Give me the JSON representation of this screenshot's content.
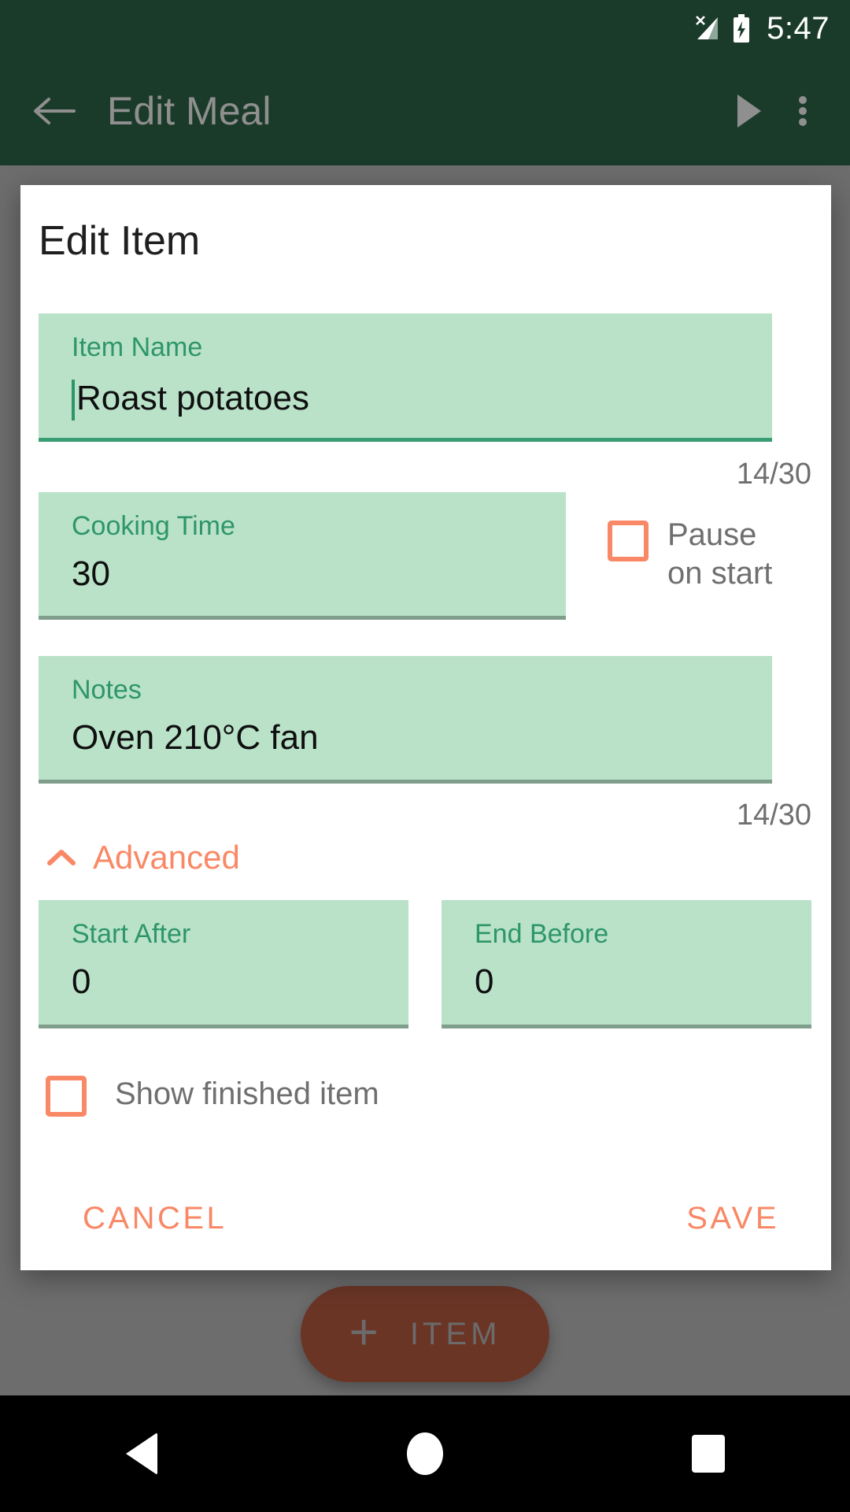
{
  "status_bar": {
    "clock": "5:47",
    "signal_icon": "signal-no-sim-icon",
    "battery_icon": "battery-charging-icon"
  },
  "app_bar": {
    "back_icon": "arrow-back-icon",
    "title": "Edit Meal",
    "play_icon": "play-icon",
    "overflow_icon": "overflow-menu-icon"
  },
  "background": {
    "fab": {
      "plus_icon": "plus-icon",
      "label": "ITEM"
    }
  },
  "dialog": {
    "title": "Edit Item",
    "fields": {
      "item_name": {
        "label": "Item Name",
        "value": "Roast potatoes",
        "counter": "14/30",
        "focused": true
      },
      "cooking_time": {
        "label": "Cooking Time",
        "value": "30",
        "focused": false
      },
      "notes": {
        "label": "Notes",
        "value": "Oven 210°C fan",
        "counter": "14/30",
        "focused": false
      },
      "start_after": {
        "label": "Start After",
        "value": "0",
        "focused": false
      },
      "end_before": {
        "label": "End Before",
        "value": "0",
        "focused": false
      }
    },
    "checkboxes": {
      "pause_on_start": {
        "label": "Pause\non start",
        "checked": false
      },
      "show_finished_item": {
        "label": "Show finished item",
        "checked": false
      }
    },
    "advanced": {
      "label": "Advanced",
      "chevron_icon": "chevron-up-icon",
      "expanded": true
    },
    "actions": {
      "cancel": "CANCEL",
      "save": "SAVE"
    }
  },
  "nav_bar": {
    "back_icon": "nav-back-icon",
    "home_icon": "nav-home-icon",
    "recents_icon": "nav-recents-icon"
  },
  "colors": {
    "app_bar": "#1b3b2a",
    "field_fill": "#b9e2c9",
    "field_label": "#2e9669",
    "accent": "#f98866",
    "scrim": "#6d6d6d",
    "fab": "#6b3526"
  }
}
